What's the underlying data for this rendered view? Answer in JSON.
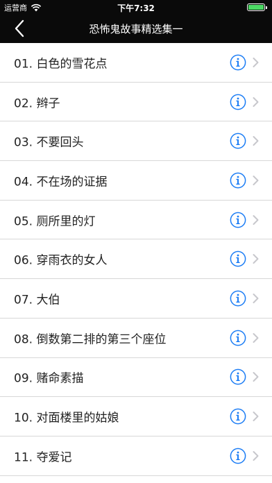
{
  "status_bar": {
    "carrier": "运营商",
    "time": "下午7:32",
    "battery_level": 1.0
  },
  "nav": {
    "title": "恐怖鬼故事精选集一"
  },
  "colors": {
    "bar_background": "#0a0a0a",
    "info_accent": "#1a7cf5",
    "chevron": "#c7c7cc",
    "separator": "#d7d7d7"
  },
  "items": [
    {
      "label": "01.  白色的雪花点"
    },
    {
      "label": "02.  辫子"
    },
    {
      "label": "03.  不要回头"
    },
    {
      "label": "04.  不在场的证据"
    },
    {
      "label": "05.  厕所里的灯"
    },
    {
      "label": "06.  穿雨衣的女人"
    },
    {
      "label": "07.  大伯"
    },
    {
      "label": "08.  倒数第二排的第三个座位"
    },
    {
      "label": "09.  赌命素描"
    },
    {
      "label": "10.  对面楼里的姑娘"
    },
    {
      "label": "11.  夺爱记"
    }
  ]
}
